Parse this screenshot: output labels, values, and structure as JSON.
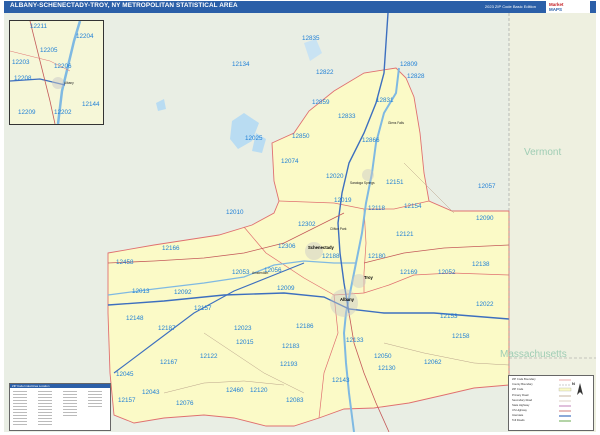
{
  "header": {
    "title": "ALBANY-SCHENECTADY-TROY, NY METROPOLITAN STATISTICAL AREA",
    "edition": "2023 ZIP Code Basic Edition",
    "logo_line1": "Market",
    "logo_line2": "MAPS"
  },
  "states": [
    {
      "name": "Vermont"
    },
    {
      "name": "Massachusetts"
    }
  ],
  "inset": {
    "zips": [
      "12211",
      "12204",
      "12205",
      "12203",
      "12206",
      "12208",
      "12144",
      "12209",
      "12202"
    ],
    "city": "Albany"
  },
  "zips": [
    "12835",
    "12134",
    "12822",
    "12809",
    "12828",
    "12859",
    "12831",
    "12833",
    "12025",
    "12850",
    "12866",
    "12074",
    "12020",
    "12151",
    "12057",
    "12010",
    "12019",
    "12118",
    "12154",
    "12090",
    "12302",
    "12121",
    "12166",
    "12306",
    "12188",
    "12180",
    "12138",
    "12458",
    "12053",
    "12056",
    "12169",
    "12052",
    "12013",
    "12092",
    "12009",
    "12022",
    "12148",
    "12157",
    "12023",
    "12186",
    "12153",
    "12187",
    "12158",
    "12183",
    "12122",
    "12193",
    "12167",
    "12015",
    "12050",
    "12045",
    "12043",
    "12130",
    "12076",
    "12460",
    "12120",
    "12083",
    "12157",
    "12143",
    "12062",
    "12133"
  ],
  "cities": {
    "schenectady": "Schenectady",
    "albany": "Albany",
    "troy": "Troy",
    "saratoga": "Saratoga Springs",
    "amsterdam": "Amsterdam",
    "clifton_park": "Clifton Park",
    "glens_falls": "Glens Falls"
  },
  "legend": {
    "rows": [
      "ZIP Code Boundary",
      "County Boundary",
      "ZIP Code",
      "Primary Road",
      "Secondary Road",
      "State Highway",
      "US Highway",
      "Interstate",
      "Toll Roads"
    ]
  },
  "zip_index": {
    "title": "ZIP Code Index/Area Location"
  },
  "compass": {
    "label": "N"
  }
}
